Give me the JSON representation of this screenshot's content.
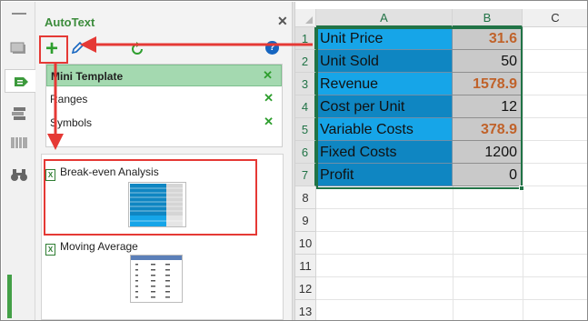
{
  "pane": {
    "title": "AutoText",
    "close_icon": "close-icon",
    "toolbar": {
      "add_icon": "plus-icon",
      "add_glyph": "+",
      "edit_icon": "edit-icon",
      "refresh_icon": "refresh-icon",
      "help_icon": "help-icon",
      "help_glyph": "?"
    },
    "groups": [
      {
        "label": "Mini Template",
        "selected": true,
        "close_icon": "close-icon"
      },
      {
        "label": "Ranges",
        "selected": false,
        "close_icon": "close-icon"
      },
      {
        "label": "Symbols",
        "selected": false,
        "close_icon": "close-icon"
      }
    ],
    "entries": [
      {
        "label": "Break-even Analysis",
        "icon": "excel-file-icon",
        "highlighted": true
      },
      {
        "label": "Moving Average",
        "icon": "excel-file-icon",
        "highlighted": false
      }
    ],
    "excel_glyph": "X"
  },
  "rail": {
    "icons": [
      "window-icon",
      "autotext-icon",
      "layers-icon",
      "columns-icon",
      "binoculars-icon"
    ],
    "active": "autotext-icon"
  },
  "sheet": {
    "columns": [
      "A",
      "B",
      "C"
    ],
    "selected_columns": [
      "A",
      "B"
    ],
    "row_numbers": [
      "1",
      "2",
      "3",
      "4",
      "5",
      "6",
      "7",
      "8",
      "9",
      "10",
      "11",
      "12",
      "13"
    ],
    "selected_rows": [
      "1",
      "2",
      "3",
      "4",
      "5",
      "6",
      "7"
    ],
    "rows": [
      {
        "label": "Unit Price",
        "value": "31.6",
        "calculated": true
      },
      {
        "label": "Unit Sold",
        "value": "50",
        "calculated": false
      },
      {
        "label": "Revenue",
        "value": "1578.9",
        "calculated": true
      },
      {
        "label": "Cost per Unit",
        "value": "12",
        "calculated": false
      },
      {
        "label": "Variable Costs",
        "value": "378.9",
        "calculated": true
      },
      {
        "label": "Fixed Costs",
        "value": "1200",
        "calculated": false
      },
      {
        "label": "Profit",
        "value": "0",
        "calculated": false
      }
    ]
  },
  "colors": {
    "accent_green": "#217346",
    "plus_green": "#2e9e2e",
    "annotation_red": "#e53935",
    "label_cell_blue": "#0f86c2",
    "label_cell_bright": "#16a5e8",
    "value_cell_gray": "#c9c9c9",
    "calculated_text": "#c0622a",
    "group_selected": "#a4d9b0"
  }
}
